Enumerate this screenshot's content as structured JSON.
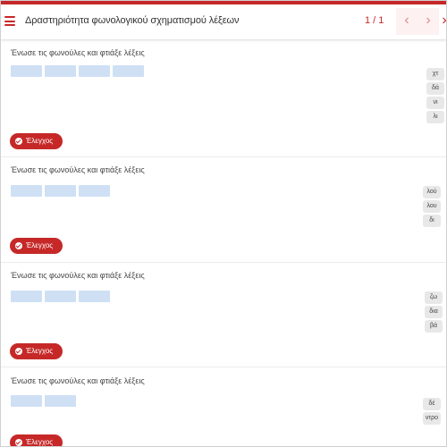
{
  "header": {
    "title": "Δραστηριότητα φωνολογικού σχηματισμού λέξεων",
    "pager": "1 / 1",
    "prev_glyph": "‹",
    "next_glyph": "›",
    "close_glyph": "›"
  },
  "instruction": "Ένωσε τις φωνούλες και φτιάξε λέξεις",
  "check_label": "Έλεγχος",
  "exercises": [
    {
      "tiles": [
        "χτ",
        "δά",
        "νι",
        "λι"
      ],
      "slot_count": 4
    },
    {
      "tiles": [
        "λού",
        "λου",
        "δι"
      ],
      "slot_count": 3
    },
    {
      "tiles": [
        "ζω",
        "δια",
        "βά"
      ],
      "slot_count": 3
    },
    {
      "tiles": [
        "δέ",
        "ντρο"
      ],
      "slot_count": 2
    }
  ],
  "colors": {
    "accent": "#c62828",
    "slot": "#cfe0f5",
    "tile": "#e8e8e8"
  }
}
